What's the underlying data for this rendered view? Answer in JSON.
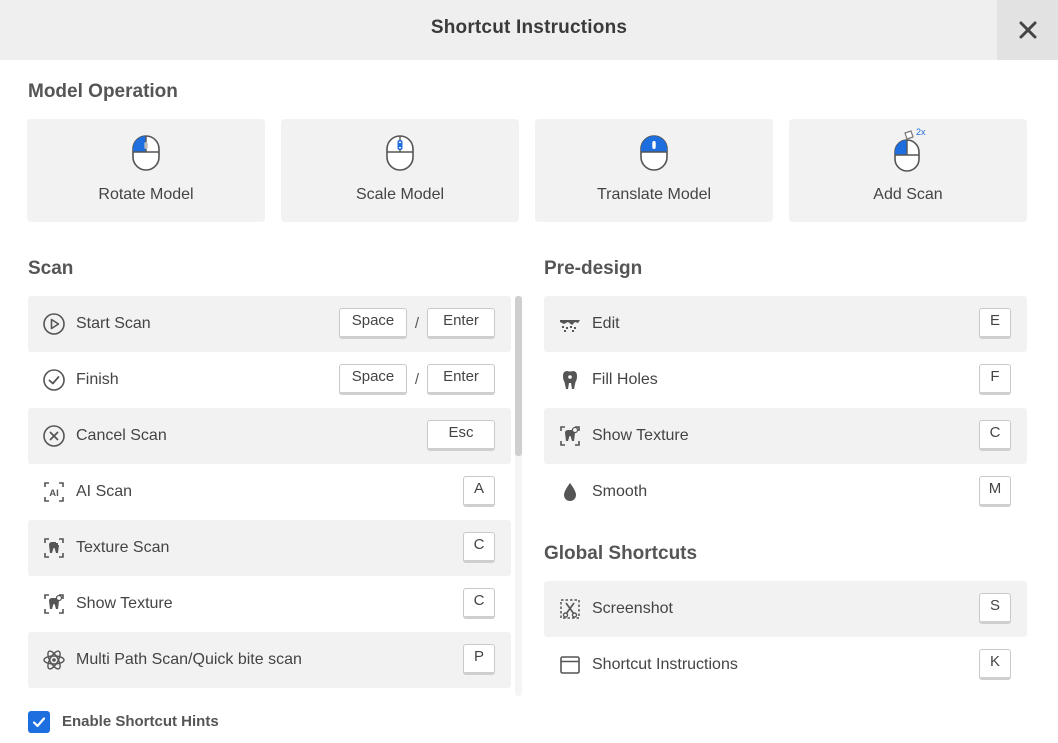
{
  "title": "Shortcut Instructions",
  "sections": {
    "model_operation": "Model Operation",
    "scan": "Scan",
    "predesign": "Pre-design",
    "global": "Global Shortcuts"
  },
  "model_operation": [
    {
      "label": "Rotate Model",
      "icon": "mouse-left-click-icon"
    },
    {
      "label": "Scale Model",
      "icon": "mouse-scroll-icon"
    },
    {
      "label": "Translate Model",
      "icon": "mouse-right-click-icon"
    },
    {
      "label": "Add Scan",
      "icon": "mouse-double-click-icon",
      "badge": "2x"
    }
  ],
  "scan": [
    {
      "label": "Start Scan",
      "icon": "play-circle-icon",
      "keys": [
        "Space",
        "Enter"
      ],
      "sep": "/"
    },
    {
      "label": "Finish",
      "icon": "check-circle-icon",
      "keys": [
        "Space",
        "Enter"
      ],
      "sep": "/"
    },
    {
      "label": "Cancel Scan",
      "icon": "cancel-circle-icon",
      "keys": [
        "Esc"
      ]
    },
    {
      "label": "AI Scan",
      "icon": "ai-scan-icon",
      "keys": [
        "A"
      ]
    },
    {
      "label": "Texture Scan",
      "icon": "texture-scan-icon",
      "keys": [
        "C"
      ]
    },
    {
      "label": "Show Texture",
      "icon": "show-texture-icon",
      "keys": [
        "C"
      ]
    },
    {
      "label": "Multi Path Scan/Quick bite scan",
      "icon": "multi-path-icon",
      "keys": [
        "P"
      ]
    }
  ],
  "predesign": [
    {
      "label": "Edit",
      "icon": "edit-icon",
      "keys": [
        "E"
      ]
    },
    {
      "label": "Fill Holes",
      "icon": "tooth-icon",
      "keys": [
        "F"
      ]
    },
    {
      "label": "Show Texture",
      "icon": "show-texture-icon",
      "keys": [
        "C"
      ]
    },
    {
      "label": "Smooth",
      "icon": "droplet-icon",
      "keys": [
        "M"
      ]
    }
  ],
  "global": [
    {
      "label": "Screenshot",
      "icon": "screenshot-icon",
      "keys": [
        "S"
      ]
    },
    {
      "label": "Shortcut Instructions",
      "icon": "window-icon",
      "keys": [
        "K"
      ]
    }
  ],
  "enable_hints": {
    "label": "Enable Shortcut Hints",
    "checked": true
  },
  "colors": {
    "accent": "#1d6fe0",
    "row_bg": "#f2f2f2",
    "titlebar_bg": "#efefef"
  }
}
